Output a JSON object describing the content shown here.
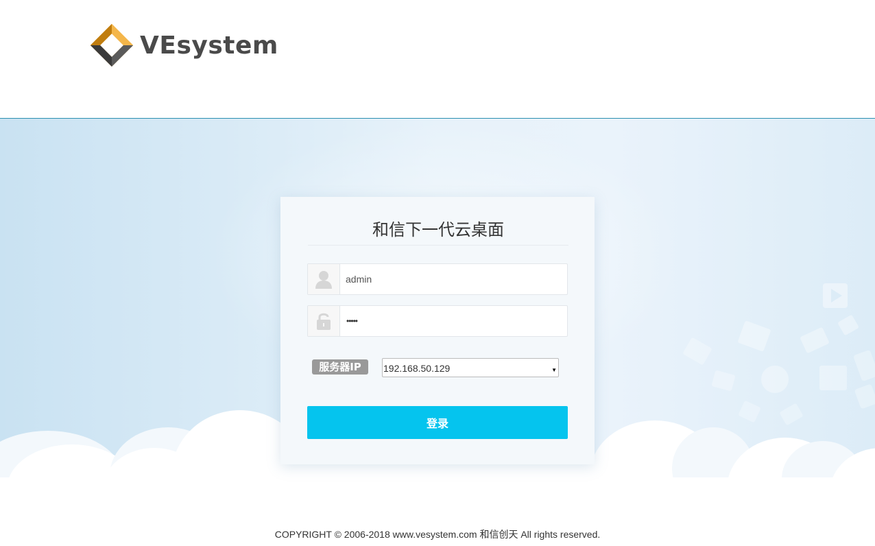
{
  "brand": {
    "logo_text": "VEsystem"
  },
  "login": {
    "title": "和信下一代云桌面",
    "username_value": "admin",
    "password_mask": "•••••",
    "server_label": "服务器IP",
    "server_selected": "192.168.50.129",
    "submit_label": "登录"
  },
  "footer": {
    "copyright": "COPYRIGHT © 2006-2018 www.vesystem.com 和信创天 All rights reserved."
  },
  "colors": {
    "accent": "#05c4ee",
    "logo_orange": "#f0a01e",
    "logo_gray": "#4a4a4a",
    "header_border": "#2a8fb0"
  },
  "icons": [
    "vesystem-logo-icon",
    "user-icon",
    "lock-icon",
    "chevron-down-icon"
  ]
}
